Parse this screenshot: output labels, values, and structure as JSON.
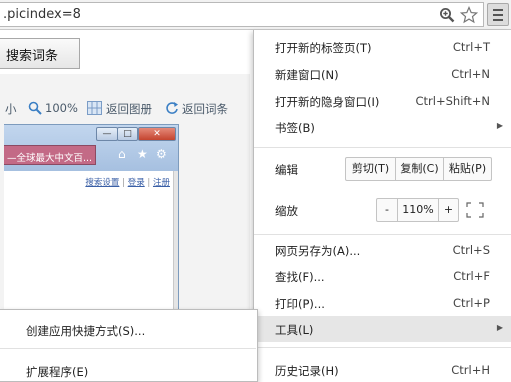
{
  "browser": {
    "url_text": ".picindex=8",
    "zoom_icon": "zoom-magnifier-icon",
    "star_icon": "bookmark-star-icon",
    "menu_icon": "hamburger-menu-icon"
  },
  "page": {
    "search_button": "搜索词条",
    "tools": {
      "zoom_prefix": "小",
      "zoom_value": "100%",
      "back_to_album": "返回图册",
      "back_to_entry": "返回词条"
    },
    "inner_window": {
      "tab_title": "—全球最大中文百...",
      "link_1": "搜索设置",
      "sep": "|",
      "link_2": "登录",
      "link_3": "注册"
    }
  },
  "menu": {
    "new_tab": {
      "label": "打开新的标签页(T)",
      "shortcut": "Ctrl+T"
    },
    "new_window": {
      "label": "新建窗口(N)",
      "shortcut": "Ctrl+N"
    },
    "incognito": {
      "label": "打开新的隐身窗口(I)",
      "shortcut": "Ctrl+Shift+N"
    },
    "bookmarks": {
      "label": "书签(B)"
    },
    "edit": {
      "label": "编辑",
      "cut": "剪切(T)",
      "copy": "复制(C)",
      "paste": "粘贴(P)"
    },
    "zoom": {
      "label": "缩放",
      "minus": "-",
      "value": "110%",
      "plus": "+"
    },
    "save_as": {
      "label": "网页另存为(A)...",
      "shortcut": "Ctrl+S"
    },
    "find": {
      "label": "查找(F)...",
      "shortcut": "Ctrl+F"
    },
    "print": {
      "label": "打印(P)...",
      "shortcut": "Ctrl+P"
    },
    "tools": {
      "label": "工具(L)"
    },
    "history": {
      "label": "历史记录(H)",
      "shortcut": "Ctrl+H"
    }
  },
  "submenu": {
    "create_shortcut": "创建应用快捷方式(S)...",
    "extensions": "扩展程序(E)"
  },
  "colors": {
    "accent_tab": "#c36a86",
    "link": "#3a5fa6",
    "hover_row": "#e6e6e6"
  }
}
